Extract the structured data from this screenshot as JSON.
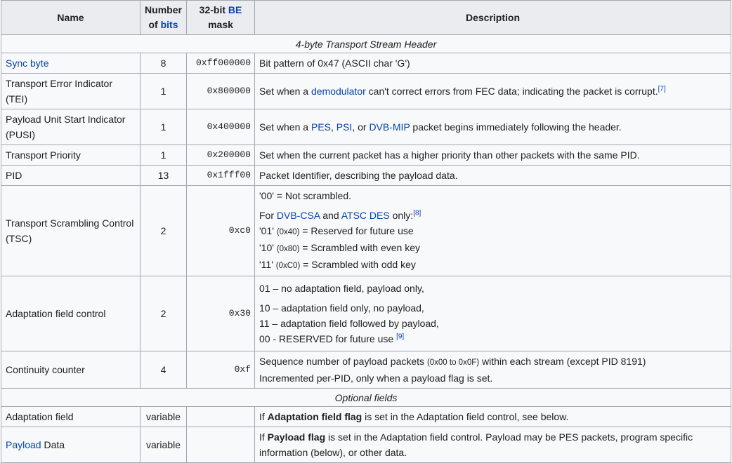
{
  "header": {
    "name": "Name",
    "bits": [
      {
        "text": "Number"
      },
      {
        "text": "of "
      },
      {
        "text": "bits",
        "link": true
      }
    ],
    "mask": [
      {
        "text": "32-bit "
      },
      {
        "text": "BE",
        "link": true
      },
      {
        "text": "mask"
      }
    ],
    "description": "Description"
  },
  "colors": {
    "link": "#0645ad",
    "border": "#a2a9b1",
    "header_bg": "#eaecf0",
    "cell_bg": "#f8f9fa"
  },
  "rows": [
    {
      "section": "4-byte Transport Stream Header"
    },
    {
      "name": [
        {
          "text": "Sync byte",
          "link": true
        }
      ],
      "bits": "8",
      "mask": "0xff000000",
      "h": 27,
      "desc": [
        [
          {
            "text": "Bit pattern of 0x47 (ASCII char 'G')"
          }
        ]
      ]
    },
    {
      "name": [
        {
          "text": "Transport Error Indicator (TEI)"
        }
      ],
      "bits": "1",
      "mask": "0x800000",
      "h": 49,
      "desc": [
        [
          {
            "text": "Set when a "
          },
          {
            "text": "demodulator",
            "link": true
          },
          {
            "text": " can't correct errors from FEC data; indicating the packet is corrupt."
          },
          {
            "text": "[7]",
            "sup": true
          }
        ]
      ]
    },
    {
      "name": [
        {
          "text": "Payload Unit Start Indicator (PUSI)"
        }
      ],
      "bits": "1",
      "mask": "0x400000",
      "h": 49,
      "desc": [
        [
          {
            "text": "Set when a "
          },
          {
            "text": "PES",
            "link": true
          },
          {
            "text": ", "
          },
          {
            "text": "PSI",
            "link": true
          },
          {
            "text": ", or "
          },
          {
            "text": "DVB-MIP",
            "link": true
          },
          {
            "text": " packet begins immediately following the header."
          }
        ]
      ]
    },
    {
      "name": [
        {
          "text": "Transport Priority"
        }
      ],
      "bits": "1",
      "mask": "0x200000",
      "h": 27,
      "desc": [
        [
          {
            "text": "Set when the current packet has a higher priority than other packets with the same PID."
          }
        ]
      ]
    },
    {
      "name": [
        {
          "text": "PID"
        }
      ],
      "bits": "13",
      "mask": "0x1fff00",
      "h": 27,
      "desc": [
        [
          {
            "text": "Packet Identifier, describing the payload data."
          }
        ]
      ]
    },
    {
      "name": [
        {
          "text": "Transport Scrambling Control (TSC)"
        }
      ],
      "bits": "2",
      "mask": "0xc0",
      "h": 129,
      "desc": [
        [
          {
            "text": "'00' = Not scrambled."
          }
        ],
        [
          {
            "text": "For "
          },
          {
            "text": "DVB-CSA",
            "link": true
          },
          {
            "text": " and "
          },
          {
            "text": "ATSC DES",
            "link": true
          },
          {
            "text": " only:"
          },
          {
            "text": "[8]",
            "sup": true
          }
        ],
        [
          {
            "text": "'01' "
          },
          {
            "text": "(0x40)",
            "small": true
          },
          {
            "text": " = Reserved for future use"
          }
        ],
        [
          {
            "text": "'10' "
          },
          {
            "text": "(0x80)",
            "small": true
          },
          {
            "text": " = Scrambled with even key"
          }
        ],
        [
          {
            "text": "'11' "
          },
          {
            "text": "(0xC0)",
            "small": true
          },
          {
            "text": " = Scrambled with odd key"
          }
        ]
      ],
      "gaps": [
        1
      ]
    },
    {
      "name": [
        {
          "text": "Adaptation field control"
        }
      ],
      "bits": "2",
      "mask": "0x30",
      "h": 107,
      "desc": [
        [
          {
            "text": "01 – no adaptation field, payload only,"
          }
        ],
        [
          {
            "text": "10 – adaptation field only, no payload,"
          }
        ],
        [
          {
            "text": "11 – adaptation field followed by payload,"
          }
        ],
        [
          {
            "text": "00 - RESERVED for future use "
          },
          {
            "text": "[9]",
            "sup": true
          }
        ]
      ],
      "gaps": [
        1
      ]
    },
    {
      "name": [
        {
          "text": "Continuity counter"
        }
      ],
      "bits": "4",
      "mask": "0xf",
      "h": 50,
      "desc": [
        [
          {
            "text": "Sequence number of payload packets "
          },
          {
            "text": "(0x00 to 0x0F)",
            "small": true
          },
          {
            "text": " within each stream (except PID 8191)"
          }
        ],
        [
          {
            "text": "Incremented per-PID, only when a payload flag is set."
          }
        ]
      ]
    },
    {
      "section": "Optional fields"
    },
    {
      "name": [
        {
          "text": "Adaptation field"
        }
      ],
      "bits": "variable",
      "mask": "",
      "h": 27,
      "desc": [
        [
          {
            "text": "If "
          },
          {
            "text": "Adaptation field flag",
            "bold": true
          },
          {
            "text": " is set in the Adaptation field control, see below."
          }
        ]
      ]
    },
    {
      "name": [
        {
          "text": "Payload",
          "link": true
        },
        {
          "text": " Data"
        }
      ],
      "bits": "variable",
      "mask": "",
      "h": 49,
      "desc": [
        [
          {
            "text": "If "
          },
          {
            "text": "Payload flag",
            "bold": true
          },
          {
            "text": " is set in the Adaptation field control. Payload may be PES packets, program specific information (below), or other data."
          }
        ]
      ]
    }
  ]
}
